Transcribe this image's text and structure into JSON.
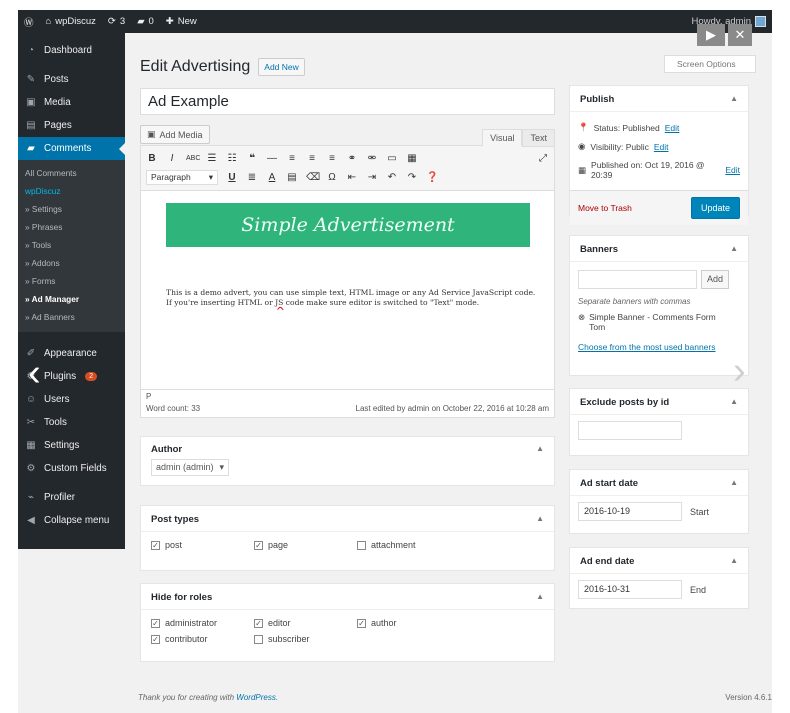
{
  "adminbar": {
    "site_name": "wpDiscuz",
    "updates": "3",
    "comments": "0",
    "new_label": "New",
    "howdy": "Howdy, admin"
  },
  "sidebar": {
    "items_top": [
      {
        "label": "Dashboard",
        "icon": "gauge-icon",
        "glyph": "◔"
      },
      {
        "label": "Posts",
        "icon": "pin-icon",
        "glyph": "✎"
      },
      {
        "label": "Media",
        "icon": "media-icon",
        "glyph": "▣"
      },
      {
        "label": "Pages",
        "icon": "pages-icon",
        "glyph": "▤"
      },
      {
        "label": "Comments",
        "icon": "comment-icon",
        "glyph": "▰"
      }
    ],
    "submenu": [
      "All Comments",
      "wpDiscuz",
      "» Settings",
      "» Phrases",
      "» Tools",
      "» Addons",
      "» Forms",
      "» Ad Manager",
      "» Ad Banners"
    ],
    "items_bottom": [
      {
        "label": "Appearance",
        "icon": "brush-icon",
        "glyph": "✐"
      },
      {
        "label": "Plugins",
        "icon": "plug-icon",
        "glyph": "⚙",
        "badge": "2"
      },
      {
        "label": "Users",
        "icon": "users-icon",
        "glyph": "☺"
      },
      {
        "label": "Tools",
        "icon": "wrench-icon",
        "glyph": "✂"
      },
      {
        "label": "Settings",
        "icon": "settings-icon",
        "glyph": "▦"
      },
      {
        "label": "Custom Fields",
        "icon": "gear-icon",
        "glyph": "⚙"
      },
      {
        "label": "Profiler",
        "icon": "chart-icon",
        "glyph": "⌁"
      },
      {
        "label": "Collapse menu",
        "icon": "collapse-icon",
        "glyph": "◀"
      }
    ]
  },
  "header": {
    "title": "Edit Advertising",
    "add_new": "Add New",
    "screen_options": "Screen Options"
  },
  "post": {
    "title": "Ad Example"
  },
  "editor": {
    "add_media": "Add Media",
    "tab_visual": "Visual",
    "tab_text": "Text",
    "format": "Paragraph",
    "banner_text": "Simple Advertisement",
    "body_text_pre": "This is a demo advert, you can use simple text, HTML image or any Ad Service JavaScript code. If you're inserting HTML or ",
    "body_text_js": "JS",
    "body_text_post": " code make sure editor is switched to \"Text\" mode.",
    "path": "P",
    "word_count": "Word count: 33",
    "last_edited": "Last edited by admin on October 22, 2016 at 10:28 am"
  },
  "author": {
    "title": "Author",
    "value": "admin (admin)"
  },
  "post_types": {
    "title": "Post types",
    "items": [
      {
        "label": "post",
        "checked": true
      },
      {
        "label": "page",
        "checked": true
      },
      {
        "label": "attachment",
        "checked": false
      }
    ]
  },
  "roles": {
    "title": "Hide for roles",
    "row1": [
      {
        "label": "administrator",
        "checked": true
      },
      {
        "label": "editor",
        "checked": true
      },
      {
        "label": "author",
        "checked": true
      }
    ],
    "row2": [
      {
        "label": "contributor",
        "checked": true
      },
      {
        "label": "subscriber",
        "checked": false
      }
    ]
  },
  "publish": {
    "title": "Publish",
    "status": "Status: Published",
    "visibility": "Visibility: Public",
    "published_on": "Published on: Oct 19, 2016 @ 20:39",
    "edit": "Edit",
    "trash": "Move to Trash",
    "update": "Update"
  },
  "banners": {
    "title": "Banners",
    "add": "Add",
    "hint": "Separate banners with commas",
    "tag": "Simple Banner - Comments Form",
    "tag_line2": "Tom",
    "choose": "Choose from the most used banners"
  },
  "exclude": {
    "title": "Exclude posts by id"
  },
  "start_date": {
    "title": "Ad start date",
    "value": "2016-10-19",
    "label": "Start"
  },
  "end_date": {
    "title": "Ad end date",
    "value": "2016-10-31",
    "label": "End"
  },
  "footer": {
    "thanks_pre": "Thank you for creating with ",
    "thanks_link": "WordPress",
    "version": "Version 4.6.1"
  }
}
